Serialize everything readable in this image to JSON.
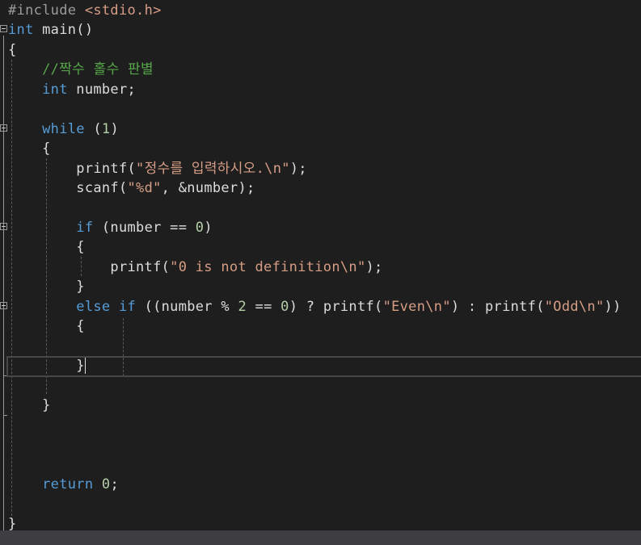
{
  "editor": {
    "lines": [
      [
        [
          "pp",
          "#include "
        ],
        [
          "str",
          "<stdio.h>"
        ]
      ],
      [
        [
          "kw",
          "int"
        ],
        [
          "pl",
          " main()"
        ]
      ],
      [
        [
          "pl",
          "{"
        ]
      ],
      [
        [
          "pl",
          "    "
        ],
        [
          "cm",
          "//짝수 홀수 판별"
        ]
      ],
      [
        [
          "pl",
          "    "
        ],
        [
          "kw",
          "int"
        ],
        [
          "pl",
          " number;"
        ]
      ],
      [],
      [
        [
          "pl",
          "    "
        ],
        [
          "kw",
          "while"
        ],
        [
          "pl",
          " ("
        ],
        [
          "num",
          "1"
        ],
        [
          "pl",
          ")"
        ]
      ],
      [
        [
          "pl",
          "    {"
        ]
      ],
      [
        [
          "pl",
          "        printf("
        ],
        [
          "str",
          "\"정수를 입력하시오.\\n\""
        ],
        [
          "pl",
          ");"
        ]
      ],
      [
        [
          "pl",
          "        scanf("
        ],
        [
          "str",
          "\"%d\""
        ],
        [
          "pl",
          ", &number);"
        ]
      ],
      [],
      [
        [
          "pl",
          "        "
        ],
        [
          "kw",
          "if"
        ],
        [
          "pl",
          " (number == "
        ],
        [
          "num",
          "0"
        ],
        [
          "pl",
          ")"
        ]
      ],
      [
        [
          "pl",
          "        {"
        ]
      ],
      [
        [
          "pl",
          "            printf("
        ],
        [
          "str",
          "\"0 is not definition\\n\""
        ],
        [
          "pl",
          ");"
        ]
      ],
      [
        [
          "pl",
          "        }"
        ]
      ],
      [
        [
          "pl",
          "        "
        ],
        [
          "kw",
          "else if"
        ],
        [
          "pl",
          " ((number % "
        ],
        [
          "num",
          "2"
        ],
        [
          "pl",
          " == "
        ],
        [
          "num",
          "0"
        ],
        [
          "pl",
          ") ? printf("
        ],
        [
          "str",
          "\"Even\\n\""
        ],
        [
          "pl",
          ") : printf("
        ],
        [
          "str",
          "\"Odd\\n\""
        ],
        [
          "pl",
          "))"
        ]
      ],
      [
        [
          "pl",
          "        {"
        ]
      ],
      [],
      [
        [
          "pl",
          "        }"
        ]
      ],
      [],
      [
        [
          "pl",
          "    }"
        ]
      ],
      [],
      [],
      [],
      [
        [
          "pl",
          "    "
        ],
        [
          "kw",
          "return"
        ],
        [
          "pl",
          " "
        ],
        [
          "num",
          "0"
        ],
        [
          "pl",
          ";"
        ]
      ],
      [],
      [
        [
          "pl",
          "}"
        ]
      ]
    ],
    "current_line": 19
  }
}
